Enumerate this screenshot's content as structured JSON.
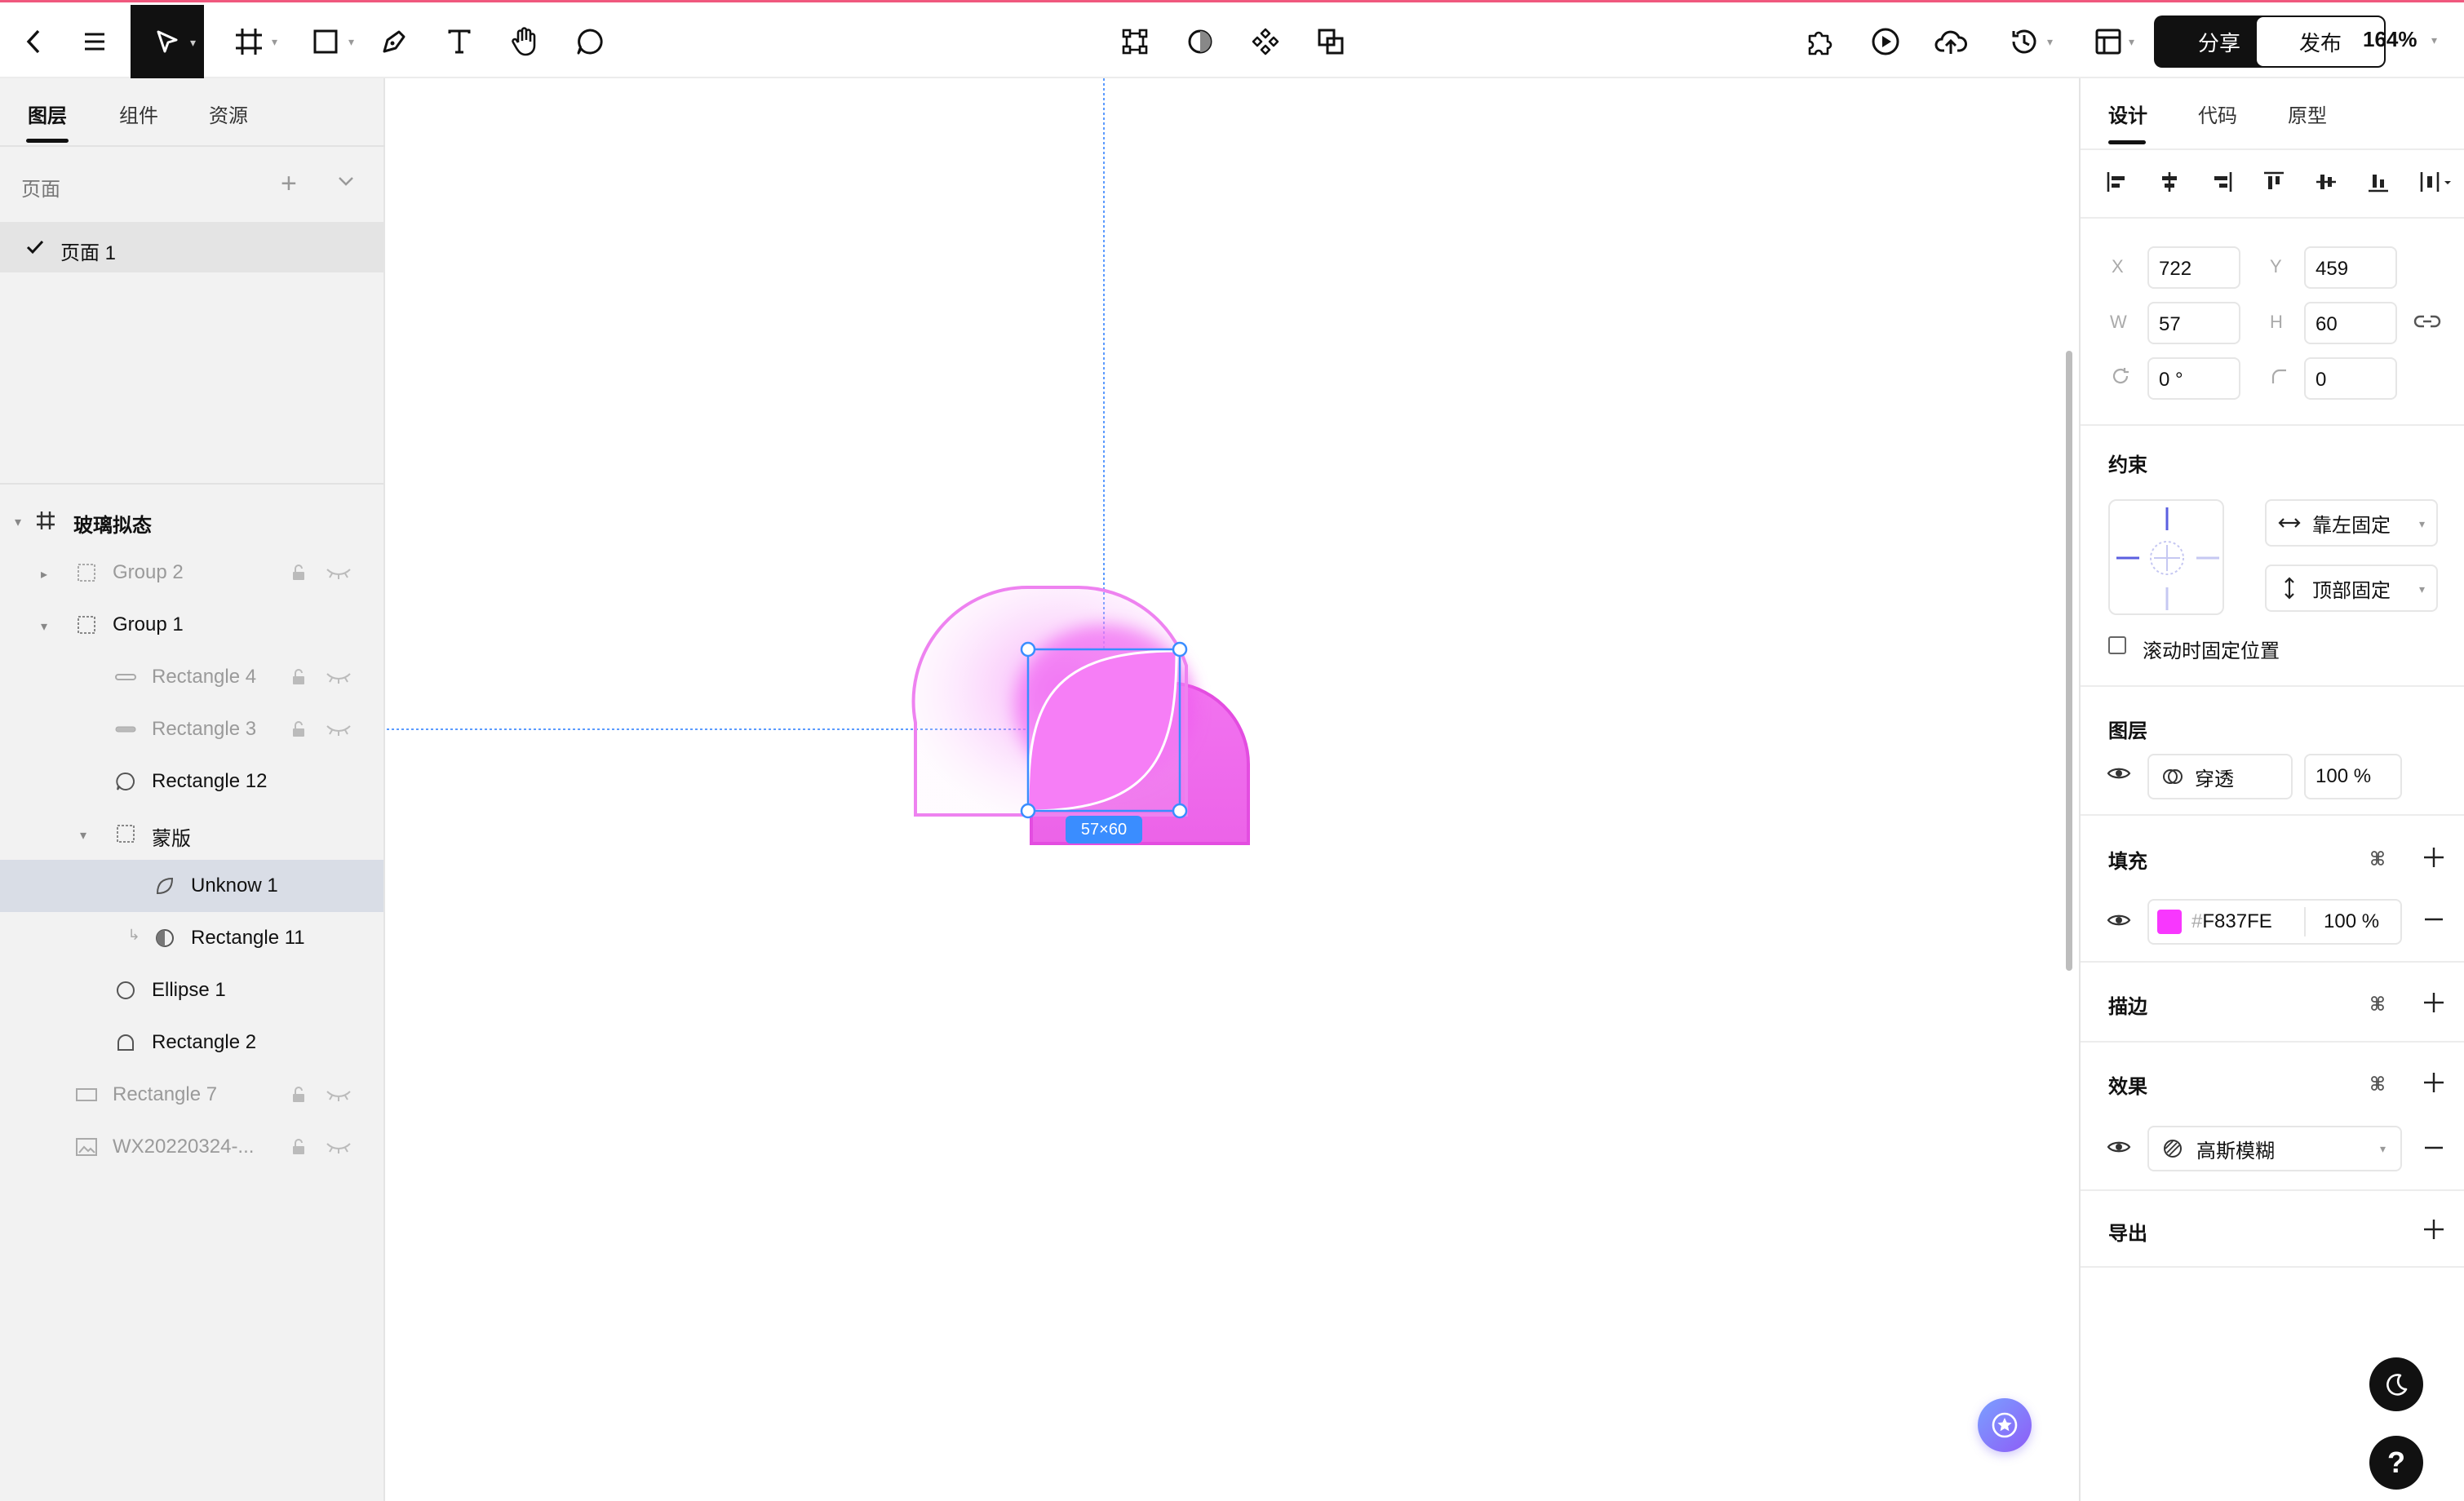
{
  "toolbar": {
    "share_label": "分享",
    "publish_label": "发布",
    "zoom": "164%"
  },
  "left_panel": {
    "tabs": [
      "图层",
      "组件",
      "资源"
    ],
    "pages_title": "页面",
    "pages": [
      {
        "label": "页面 1",
        "active": true
      }
    ],
    "layers": [
      {
        "name": "玻璃拟态",
        "kind": "frame"
      },
      {
        "name": "Group 2",
        "kind": "group"
      },
      {
        "name": "Group 1",
        "kind": "group"
      },
      {
        "name": "Rectangle 4",
        "kind": "line"
      },
      {
        "name": "Rectangle 3",
        "kind": "line"
      },
      {
        "name": "Rectangle 12",
        "kind": "shape"
      },
      {
        "name": "蒙版",
        "kind": "group"
      },
      {
        "name": "Unknow 1",
        "kind": "shape"
      },
      {
        "name": "Rectangle 11",
        "kind": "mask"
      },
      {
        "name": "Ellipse 1",
        "kind": "ellipse"
      },
      {
        "name": "Rectangle 2",
        "kind": "shape"
      },
      {
        "name": "Rectangle 7",
        "kind": "rect"
      },
      {
        "name": "WX20220324-...",
        "kind": "image"
      }
    ]
  },
  "canvas": {
    "dimension_badge": "57×60"
  },
  "right_panel": {
    "tabs": [
      "设计",
      "代码",
      "原型"
    ],
    "x_label": "X",
    "x": "722",
    "y_label": "Y",
    "y": "459",
    "w_label": "W",
    "w": "57",
    "h_label": "H",
    "h": "60",
    "rotation": "0 °",
    "radius": "0",
    "constraints_title": "约束",
    "constraint_h": "靠左固定",
    "constraint_v": "顶部固定",
    "fix_on_scroll": "滚动时固定位置",
    "layer_title": "图层",
    "blend_mode": "穿透",
    "layer_opacity": "100 %",
    "fill_title": "填充",
    "fill_hash": "#",
    "fill_hex": "F837FE",
    "fill_color": "#F837FE",
    "fill_opacity": "100 %",
    "stroke_title": "描边",
    "effect_title": "效果",
    "effect_name": "高斯模糊",
    "export_title": "导出"
  }
}
